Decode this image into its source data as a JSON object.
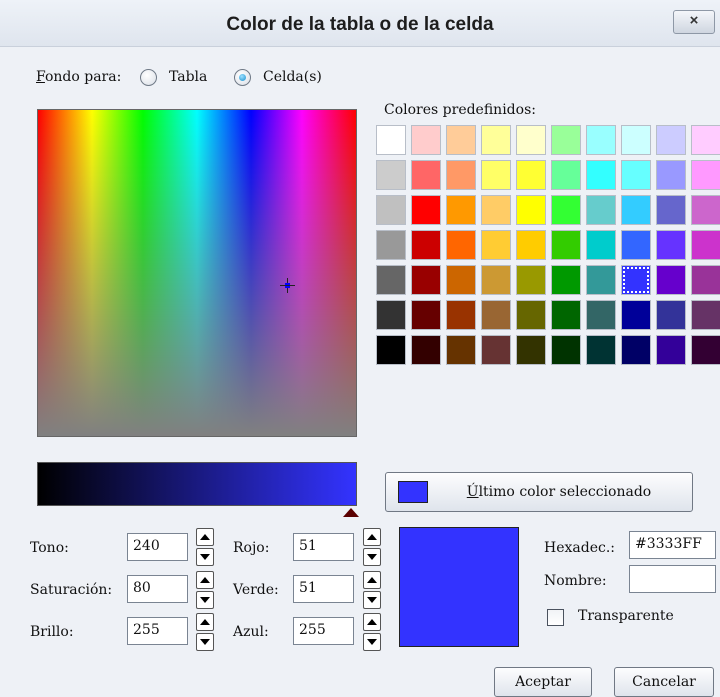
{
  "window": {
    "title": "Color de la tabla o de la celda",
    "close_label": "×"
  },
  "background_for": {
    "label_first": "F",
    "label_rest": "ondo para:",
    "options": [
      {
        "label": "Tabla",
        "checked": false
      },
      {
        "label": "Celda(s)",
        "checked": true
      }
    ]
  },
  "presets": {
    "label": "Colores predefinidos:",
    "selected": [
      4,
      7
    ],
    "rows": [
      [
        "#ffffff",
        "#ffcccc",
        "#ffcc99",
        "#ffff99",
        "#ffffcc",
        "#99ff99",
        "#99ffff",
        "#ccffff",
        "#ccccff",
        "#ffccff"
      ],
      [
        "#cccccc",
        "#ff6666",
        "#ff9966",
        "#ffff66",
        "#ffff33",
        "#66ff99",
        "#33ffff",
        "#66ffff",
        "#9999ff",
        "#ff99ff"
      ],
      [
        "#c0c0c0",
        "#ff0000",
        "#ff9900",
        "#ffcc66",
        "#ffff00",
        "#33ff33",
        "#66cccc",
        "#33ccff",
        "#6666cc",
        "#cc66cc"
      ],
      [
        "#999999",
        "#cc0000",
        "#ff6600",
        "#ffcc33",
        "#ffcc00",
        "#33cc00",
        "#00cccc",
        "#3366ff",
        "#6633ff",
        "#cc33cc"
      ],
      [
        "#666666",
        "#990000",
        "#cc6600",
        "#cc9933",
        "#999900",
        "#009900",
        "#339999",
        "#3333ff",
        "#6600cc",
        "#993399"
      ],
      [
        "#333333",
        "#660000",
        "#993300",
        "#996633",
        "#666600",
        "#006600",
        "#336666",
        "#000099",
        "#333399",
        "#663366"
      ],
      [
        "#000000",
        "#330000",
        "#663300",
        "#663333",
        "#333300",
        "#003300",
        "#003333",
        "#000066",
        "#330099",
        "#330033"
      ]
    ]
  },
  "last_color": {
    "label_first": "Ú",
    "label_rest": "ltimo color seleccionado",
    "color": "#3333FF"
  },
  "hsb": {
    "tono": {
      "label": "Tono:",
      "value": "240"
    },
    "saturacion": {
      "label": "Saturación:",
      "value": "80"
    },
    "brillo": {
      "label": "Brillo:",
      "value": "255"
    }
  },
  "rgb": {
    "rojo": {
      "label": "Rojo:",
      "value": "51"
    },
    "verde": {
      "label": "Verde:",
      "value": "51"
    },
    "azul": {
      "label": "Azul:",
      "value": "255"
    }
  },
  "hex": {
    "label": "Hexadec.:",
    "value": "#3333FF"
  },
  "name": {
    "label": "Nombre:",
    "value": ""
  },
  "transparent": {
    "label": "Transparente",
    "checked": false
  },
  "buttons": {
    "ok": "Aceptar",
    "cancel": "Cancelar"
  },
  "colors": {
    "current": "#3333FF",
    "dialog_bg": "#eef1f6"
  }
}
